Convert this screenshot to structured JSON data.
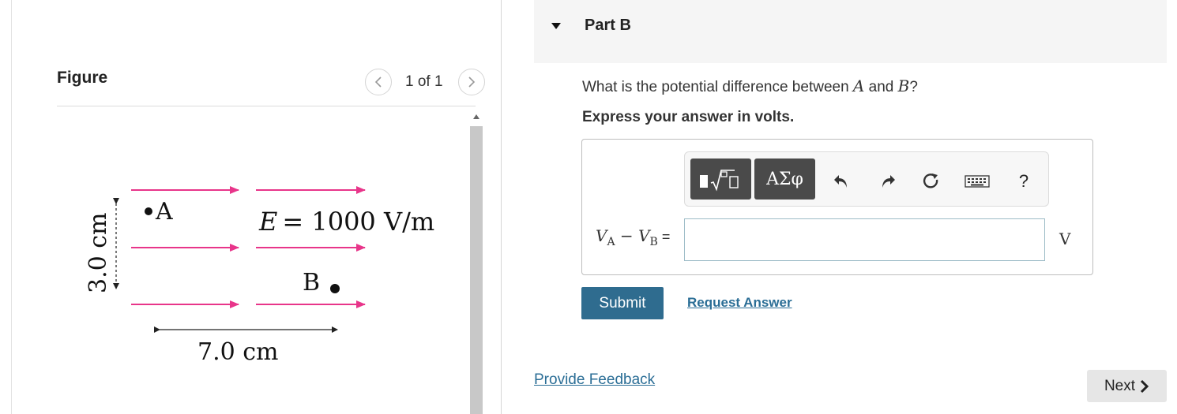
{
  "figure": {
    "title": "Figure",
    "pager": "1 of 1",
    "diagram": {
      "point_a": "A",
      "point_b": "B",
      "field_label_var": "E",
      "field_label_eq": "= 1000 V/m",
      "width_label": "7.0 cm",
      "height_label": "3.0 cm",
      "arrow_color": "#e8358a"
    }
  },
  "part_b": {
    "title": "Part B",
    "question_pre": "What is the potential difference between ",
    "question_var_a": "A",
    "question_mid": " and ",
    "question_var_b": "B",
    "question_post": "?",
    "instruction": "Express your answer in volts.",
    "toolbar": {
      "templates_icon": "template-icon",
      "symbols_label": "ΑΣφ",
      "help_label": "?"
    },
    "equation": {
      "v": "V",
      "sub_a": "A",
      "minus": " − ",
      "sub_b": "B",
      "equals": " ="
    },
    "answer": {
      "value": "",
      "placeholder": ""
    },
    "unit": "V",
    "submit_label": "Submit",
    "request_label": "Request Answer"
  },
  "feedback_label": "Provide Feedback",
  "next_label": "Next",
  "colors": {
    "accent": "#2f6c8f",
    "link": "#2b6e96",
    "field_arrow": "#e8358a"
  }
}
